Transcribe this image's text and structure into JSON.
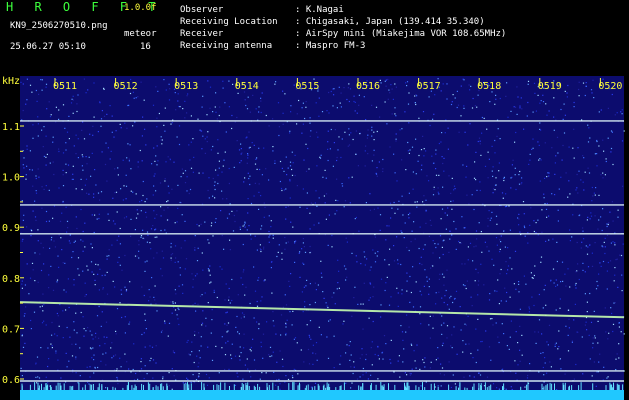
{
  "header": {
    "brand": "H R O F F T",
    "version": "1.0.0f",
    "filename": "KN9_2506270510.png",
    "meteor_label": "meteor",
    "datetime": "25.06.27 05:10",
    "meteor_count": "16",
    "fields": [
      {
        "label": "Observer",
        "value": ": K.Nagai"
      },
      {
        "label": "Receiving Location",
        "value": ": Chigasaki, Japan (139.414 35.340)"
      },
      {
        "label": "Receiver",
        "value": ": AirSpy mini (Miakejima VOR 108.65MHz)"
      },
      {
        "label": "Receiving antenna",
        "value": ": Maspro FM-3"
      }
    ]
  },
  "chart_data": {
    "type": "heatmap",
    "ylabel": "kHz",
    "ylim": [
      0.58,
      1.17
    ],
    "x_ticks": [
      "0511",
      "0512",
      "0513",
      "0514",
      "0515",
      "0516",
      "0517",
      "0518",
      "0519",
      "0520"
    ],
    "y_ticks": [
      "1.1",
      "1.0",
      "0.9",
      "0.8",
      "0.7",
      "0.6"
    ],
    "traces": [
      {
        "kind": "carrier",
        "freq_start": 1.11,
        "freq_end": 1.11
      },
      {
        "kind": "carrier",
        "freq_start": 0.944,
        "freq_end": 0.944
      },
      {
        "kind": "carrier",
        "freq_start": 0.887,
        "freq_end": 0.887
      },
      {
        "kind": "doppler",
        "freq_start": 0.752,
        "freq_end": 0.722
      },
      {
        "kind": "carrier",
        "freq_start": 0.616,
        "freq_end": 0.616
      },
      {
        "kind": "carrier",
        "freq_start": 0.596,
        "freq_end": 0.596
      }
    ],
    "colors": {
      "background": "#0c0c6e",
      "carrier": "#e8ffff",
      "doppler": "#c8ffb0",
      "noise_floor": "#20c8ff"
    }
  }
}
